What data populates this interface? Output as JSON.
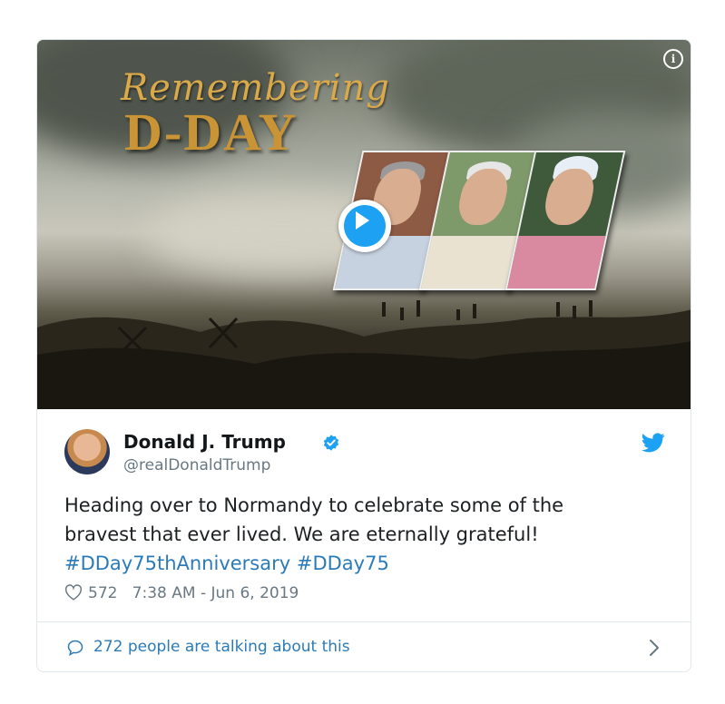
{
  "media": {
    "title_script": "Remembering",
    "title_main": "D-DAY",
    "info_icon": "info-icon",
    "play_icon": "play-icon"
  },
  "tweet": {
    "author_name": "Donald J. Trump",
    "handle": "@realDonaldTrump",
    "text_line1": "Heading over to Normandy to celebrate some of the",
    "text_line2": "bravest that ever lived. We are eternally grateful!",
    "hashtag1": "#DDay75thAnniversary",
    "hashtag2": "#DDay75",
    "likes": "572",
    "timestamp": "7:38 AM - Jun 6, 2019"
  },
  "footer": {
    "talking": "272 people are talking about this"
  },
  "colors": {
    "link": "#2b7bb9",
    "twitter_blue": "#1da1f2",
    "meta_gray": "#697882",
    "border": "#e1e8ed"
  }
}
